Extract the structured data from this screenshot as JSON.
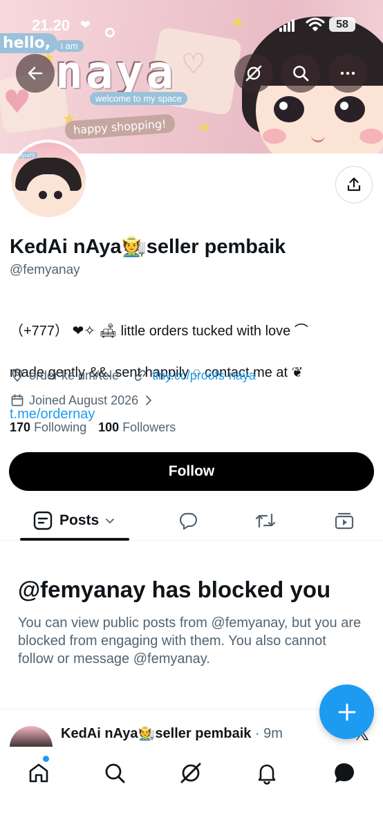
{
  "status_bar": {
    "time": "21.20",
    "heart": "❤",
    "battery": "58"
  },
  "banner": {
    "hello": "hello,",
    "i_am": "i am",
    "name_art": "naya",
    "welcome": "welcome to my space",
    "happy_shopping": "happy shopping!"
  },
  "header_buttons": {
    "back": "back-arrow-icon",
    "grok": "grok-icon",
    "search": "search-icon",
    "more": "more-icon"
  },
  "profile": {
    "display_name": "KedAi nAya🧑‍🌾seller pembaik",
    "handle": "@femyanay",
    "avatar_tag": "ayud'ji",
    "bio_line1": "（+777） ❤✧  🛋  little orders tucked with love  ⌒",
    "bio_line2": "made gently   &&.   sent happily   ◌   contact me at ❦",
    "bio_link": "t.me/ordernay",
    "location": "order ke dm/tele",
    "website": "tiny.cc/proofs-naya",
    "joined": "Joined August 2026",
    "following_count": "170",
    "following_label": "Following",
    "followers_count": "100",
    "followers_label": "Followers"
  },
  "follow_button": "Follow",
  "tabs": {
    "posts": "Posts",
    "replies_icon": "reply-icon",
    "reposts_icon": "repost-icon",
    "media_icon": "media-icon"
  },
  "blocked": {
    "title": "@femyanay has blocked you",
    "text": "You can view public posts from @femyanay, but you are blocked from engaging with them. You also cannot follow or message @femyanay."
  },
  "post_preview": {
    "name": "KedAi nAya🧑‍🌾seller pembaik",
    "time": " · 9m"
  },
  "fab": "+",
  "colors": {
    "accent": "#1d9bf0",
    "text_primary": "#0f1419",
    "text_secondary": "#536471",
    "follow_bg": "#000000"
  }
}
